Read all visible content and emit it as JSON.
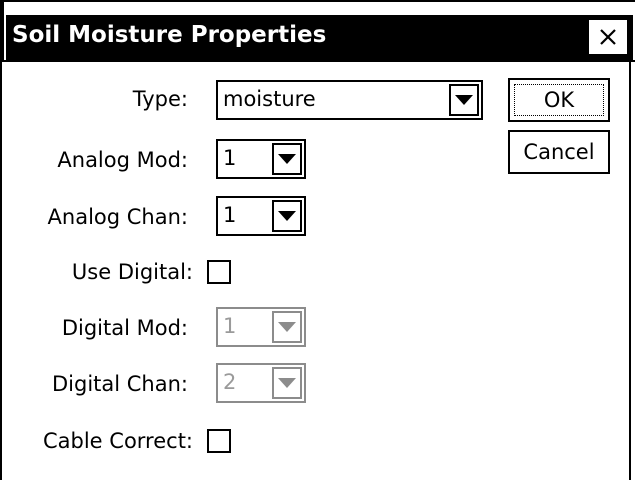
{
  "dialog": {
    "title": "Soil Moisture Properties",
    "close_label": "×"
  },
  "form": {
    "type": {
      "label": "Type:",
      "value": "moisture"
    },
    "analog_mod": {
      "label": "Analog Mod:",
      "value": "1"
    },
    "analog_chan": {
      "label": "Analog Chan:",
      "value": "1"
    },
    "use_digital": {
      "label": "Use Digital:",
      "checked": false
    },
    "digital_mod": {
      "label": "Digital Mod:",
      "value": "1",
      "enabled": false
    },
    "digital_chan": {
      "label": "Digital Chan:",
      "value": "2",
      "enabled": false
    },
    "cable_correct": {
      "label": "Cable Correct:",
      "checked": false
    }
  },
  "buttons": {
    "ok": "OK",
    "cancel": "Cancel"
  },
  "colors": {
    "title_bg": "#000000",
    "title_fg": "#ffffff",
    "disabled_text": "#9a9a9a"
  }
}
